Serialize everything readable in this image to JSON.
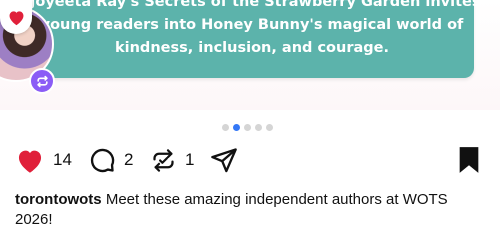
{
  "post": {
    "card_lines": [
      "Joyeeta Ray's Secrets of the Strawberry Garden invites",
      "young readers into Honey Bunny's magical world of",
      "kindness, inclusion, and courage."
    ],
    "card_color": "#5cb3ab"
  },
  "carousel": {
    "dots_count": 5,
    "active_index": 1,
    "active_color": "#3478f6"
  },
  "actions": {
    "likes": "14",
    "comments": "2",
    "reposts": "1",
    "like_color": "#e0203a"
  },
  "caption": {
    "username": "torontowots",
    "text": "Meet these amazing independent authors at WOTS 2026!"
  },
  "icons": {
    "reaction": "heart-icon",
    "badge": "repost-icon",
    "like": "heart-icon",
    "comment": "comment-bubble-icon",
    "repost": "repost-icon",
    "share": "send-icon",
    "save": "bookmark-icon"
  }
}
